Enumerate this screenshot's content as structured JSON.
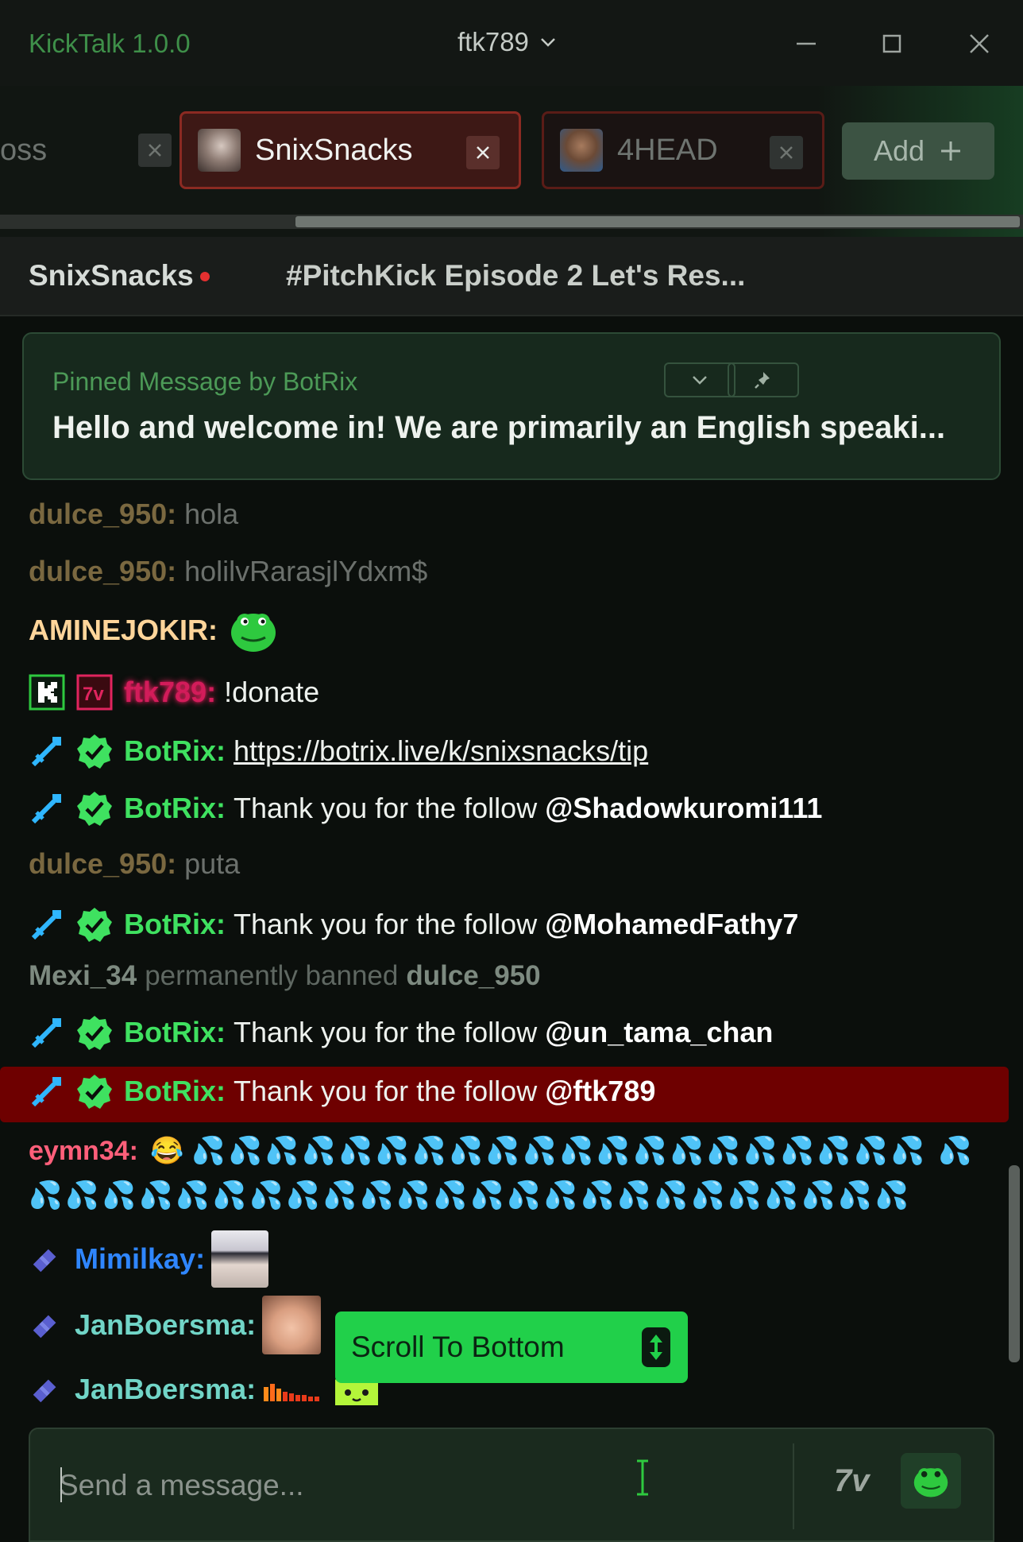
{
  "app": {
    "title": "KickTalk 1.0.0",
    "user": "ftk789"
  },
  "tabs": [
    {
      "label": "oss"
    },
    {
      "label": "SnixSnacks"
    },
    {
      "label": "4HEAD"
    }
  ],
  "add_label": "Add",
  "stream": {
    "streamer": "SnixSnacks",
    "title": "#PitchKick Episode 2 Let's Res..."
  },
  "pinned": {
    "by": "Pinned Message by BotRix",
    "message": "Hello and welcome in! We are primarily an English speaki..."
  },
  "messages": [
    {
      "user": "dulce_950:",
      "text": "hola",
      "color": "#7a6840"
    },
    {
      "user": "dulce_950:",
      "text": "holilvRarasjlYdxm$",
      "color": "#7a6840"
    },
    {
      "user": "AMINEJOKIR:",
      "text": "",
      "color": "#ffd59a"
    },
    {
      "user": "ftk789:",
      "text": "!donate",
      "color": "#d21c5a"
    },
    {
      "user": "BotRix:",
      "text": "https://botrix.live/k/snixsnacks/tip",
      "color": "#3fe160"
    },
    {
      "user": "BotRix:",
      "text": "Thank you for the follow ",
      "mention": "@Shadowkuromi111",
      "color": "#3fe160"
    },
    {
      "user": "dulce_950:",
      "text": "puta",
      "color": "#7a6840"
    },
    {
      "user": "BotRix:",
      "text": "Thank you for the follow ",
      "mention": "@MohamedFathy7",
      "color": "#3fe160"
    },
    {
      "user": "BotRix:",
      "text": "Thank you for the follow ",
      "mention": "@un_tama_chan",
      "color": "#3fe160"
    },
    {
      "user": "BotRix:",
      "text": "Thank you for the follow ",
      "mention": "@ftk789",
      "color": "#3fe160"
    },
    {
      "user": "eymn34:",
      "text": "",
      "color": "#ff5f7a"
    },
    {
      "user": "Mimilkay:",
      "text": "",
      "color": "#2f86ff"
    },
    {
      "user": "JanBoersma:",
      "text": "",
      "color": "#71d5c7"
    },
    {
      "user": "JanBoersma:",
      "text": "",
      "color": "#71d5c7"
    }
  ],
  "moderation": {
    "moderator": "Mexi_34",
    "action": "permanently banned",
    "target": "dulce_950"
  },
  "scroll_to_bottom": "Scroll To Bottom",
  "input": {
    "placeholder": "Send a message..."
  },
  "colors": {
    "accent": "#21d04a",
    "highlight": "#6e0000",
    "bg": "#0b0f0c"
  }
}
